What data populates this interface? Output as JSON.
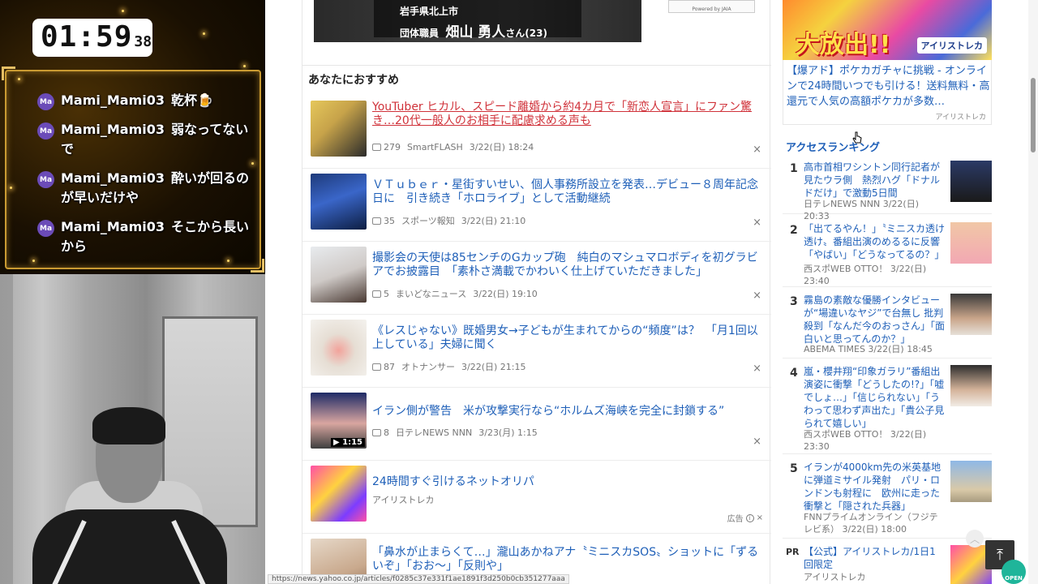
{
  "stream": {
    "timer": {
      "main": "01:59",
      "sec": "38"
    },
    "chat": [
      {
        "badge": "Ma",
        "user": "Mami_Mami03",
        "text": "乾杯🍺"
      },
      {
        "badge": "Ma",
        "user": "Mami_Mami03",
        "text": "弱なってないで"
      },
      {
        "badge": "Ma",
        "user": "Mami_Mami03",
        "text": "酔いが回るのが早いだけや"
      },
      {
        "badge": "Ma",
        "user": "Mami_Mami03",
        "text": "そこから長いから"
      }
    ]
  },
  "top_news": {
    "caption_line1": "岩手県北上市",
    "caption_line2_prefix": "団体職員",
    "caption_line2_name": "畑山 勇人",
    "caption_line2_suffix": "さん(23)",
    "ad_small": "Powered by JAIA"
  },
  "recommend": {
    "heading": "あなたにおすすめ",
    "items": [
      {
        "title": "YouTuber ヒカル、スピード離婚から約4カ月で「新恋人宣言」にファン驚き…20代一般人のお相手に配慮求める声も",
        "comments": "279",
        "source": "SmartFLASH",
        "date": "3/22(日) 18:24",
        "close": "×"
      },
      {
        "title": "ＶＴｕｂｅｒ・星街すいせい、個人事務所設立を発表…デビュー８周年記念日に　引き続き「ホロライブ」として活動継続",
        "comments": "35",
        "source": "スポーツ報知",
        "date": "3/22(日) 21:10",
        "close": "×"
      },
      {
        "title": "撮影会の天使は85センチのGカップ砲　純白のマシュマロボディを初グラビアでお披露目　「素朴さ満載でかわいく仕上げていただきました」",
        "comments": "5",
        "source": "まいどなニュース",
        "date": "3/22(日) 19:10",
        "close": "×"
      },
      {
        "title": "《レスじゃない》既婚男女→子どもが生まれてからの“頻度”は？　「月1回以上している」夫婦に聞く",
        "comments": "87",
        "source": "オトナンサー",
        "date": "3/22(日) 21:15",
        "close": "×"
      },
      {
        "title": "イラン側が警告　米が攻撃実行なら“ホルムズ海峡を完全に封鎖する”",
        "comments": "8",
        "source": "日テレNEWS NNN",
        "date": "3/23(月) 1:15",
        "close": "×",
        "video_duration": "▶ 1:15"
      },
      {
        "title": "24時間すぐ引けるネットオリパ",
        "source": "アイリストレカ",
        "ad_label": "広告",
        "close": "×"
      },
      {
        "title": "「鼻水が止まらくて…」瀧山あかねアナ〝ミニスカSOS〟ショットに「ずるいぞ」「おお～」「反則や」"
      }
    ]
  },
  "right_ad": {
    "banner_big": "大放出!!",
    "banner_brand": "アイリストレカ",
    "text": "【爆アド】ポケカガチャに挑戦 - オンラインで24時間いつでも引ける！送料無料・高還元で人気の高額ポケカが多数…",
    "brand_small": "アイリストレカ"
  },
  "ranking": {
    "heading": "アクセスランキング",
    "items": [
      {
        "num": "1",
        "title": "高市首相ワシントン同行記者が見たウラ側　熱烈ハグ「ドナルドだけ」で激動5日間",
        "meta": "日テレNEWS NNN 3/22(日) 20:33"
      },
      {
        "num": "2",
        "title": "「出てるやん！」〝ミニスカ透け透け〟番組出演のめるるに反響「やばい」「どうなってるの？」",
        "meta": "西スポWEB OTTO！ 3/22(日) 23:40"
      },
      {
        "num": "3",
        "title": "霧島の素敵な優勝インタビューが“場違いなヤジ”で台無し 批判殺到「なんだ今のおっさん」「面白いと思ってんのか？」",
        "meta": "ABEMA TIMES 3/22(日) 18:45"
      },
      {
        "num": "4",
        "title": "嵐・櫻井翔“印象ガラリ”番組出演姿に衝撃「どうしたの!?」「嘘でしょ…」「信じられない」「うわって思わず声出た」「貴公子見られて嬉しい」",
        "meta": "西スポWEB OTTO！ 3/22(日) 23:30"
      },
      {
        "num": "5",
        "title": "イランが4000km先の米英基地に弾道ミサイル発射　パリ・ロンドンも射程に　欧州に走った衝撃と「隠された兵器」",
        "meta": "FNNプライムオンライン（フジテレビ系） 3/22(日) 18:00"
      }
    ],
    "pr": {
      "label": "PR",
      "title": "【公式】アイリストレカ/1日1回限定",
      "source": "アイリストレカ"
    }
  },
  "ui": {
    "to_top": "⤒",
    "open_badge": "OPEN",
    "status_url": "https://news.yahoo.co.jp/articles/f0285c37e331f1ae1891f3d250b0cb351277aaa"
  }
}
